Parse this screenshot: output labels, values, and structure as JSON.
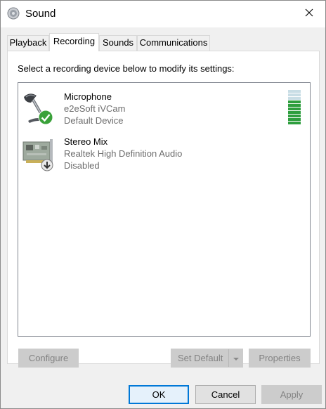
{
  "window": {
    "title": "Sound"
  },
  "tabs": [
    {
      "label": "Playback",
      "active": false
    },
    {
      "label": "Recording",
      "active": true
    },
    {
      "label": "Sounds",
      "active": false
    },
    {
      "label": "Communications",
      "active": false
    }
  ],
  "recording": {
    "instruction": "Select a recording device below to modify its settings:",
    "devices": [
      {
        "name": "Microphone",
        "description": "e2eSoft iVCam",
        "status": "Default Device",
        "icon": "microphone-icon",
        "badge": "green-check-icon",
        "level_bars_total": 10,
        "level_bars_lit": 7
      },
      {
        "name": "Stereo Mix",
        "description": "Realtek High Definition Audio",
        "status": "Disabled",
        "icon": "sound-card-icon",
        "badge": "disabled-down-arrow-icon"
      }
    ]
  },
  "panel_buttons": {
    "configure": "Configure",
    "set_default": "Set Default",
    "properties": "Properties"
  },
  "dialog_buttons": {
    "ok": "OK",
    "cancel": "Cancel",
    "apply": "Apply"
  },
  "colors": {
    "accent": "#0078d7",
    "level_lit": "#2e9e3e",
    "level_unlit": "#c8dde5",
    "check_green": "#3aa13a"
  }
}
